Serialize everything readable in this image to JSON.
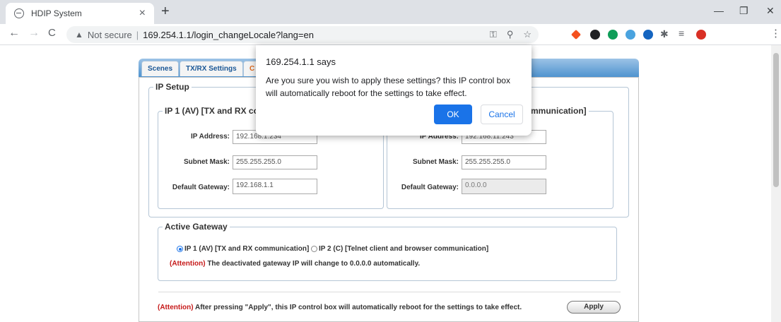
{
  "browser": {
    "tab_title": "HDIP System",
    "tab_close": "×",
    "new_tab": "+",
    "nav": {
      "back": "←",
      "forward": "→",
      "reload": "C"
    },
    "security_icon": "▲",
    "security_label": "Not secure",
    "separator": "|",
    "url": "169.254.1.1/login_changeLocale?lang=en",
    "window": {
      "minimize": "—",
      "restore": "❐",
      "close": "✕"
    },
    "omnibox_icons": {
      "key": "⚿",
      "zoom": "⚲",
      "bookmark": "☆"
    },
    "extensions": {
      "puzzle": "✱",
      "playlist": "≡",
      "menu": "⋮"
    },
    "extension_colors": [
      "#f4511e",
      "#202124",
      "#0f9d58",
      "#4aa3df",
      "#1565c0",
      "#d93025"
    ]
  },
  "page": {
    "tabs": [
      "Scenes",
      "TX/RX Settings",
      "C"
    ],
    "ip_setup": {
      "legend": "IP Setup",
      "ip1": {
        "legend": "IP 1 (AV) [TX and RX com",
        "ip_label": "IP Address:",
        "ip_value": "192.168.1.234",
        "mask_label": "Subnet Mask:",
        "mask_value": "255.255.255.0",
        "gw_label": "Default Gateway:",
        "gw_value": "192.168.1.1"
      },
      "ip2": {
        "legend": "mmunication]",
        "ip_label": "IP Address:",
        "ip_value": "192.168.11.243",
        "mask_label": "Subnet Mask:",
        "mask_value": "255.255.255.0",
        "gw_label": "Default Gateway:",
        "gw_value": "0.0.0.0"
      }
    },
    "active_gateway": {
      "legend": "Active Gateway",
      "option1": "IP 1 (AV) [TX and RX communication]",
      "option2": "IP 2 (C) [Telnet client and browser communication]",
      "attention_tag": "(Attention)",
      "attention_text": "The deactivated gateway IP will change to 0.0.0.0 automatically."
    },
    "footer": {
      "attention_tag": "(Attention)",
      "attention_text": "After pressing \"Apply\", this IP control box will automatically reboot for the settings to take effect.",
      "apply_label": "Apply"
    }
  },
  "dialog": {
    "title": "169.254.1.1 says",
    "message": "Are you sure you wish to apply these settings? this IP control box will automatically reboot for the settings to take effect.",
    "ok_label": "OK",
    "cancel_label": "Cancel"
  }
}
